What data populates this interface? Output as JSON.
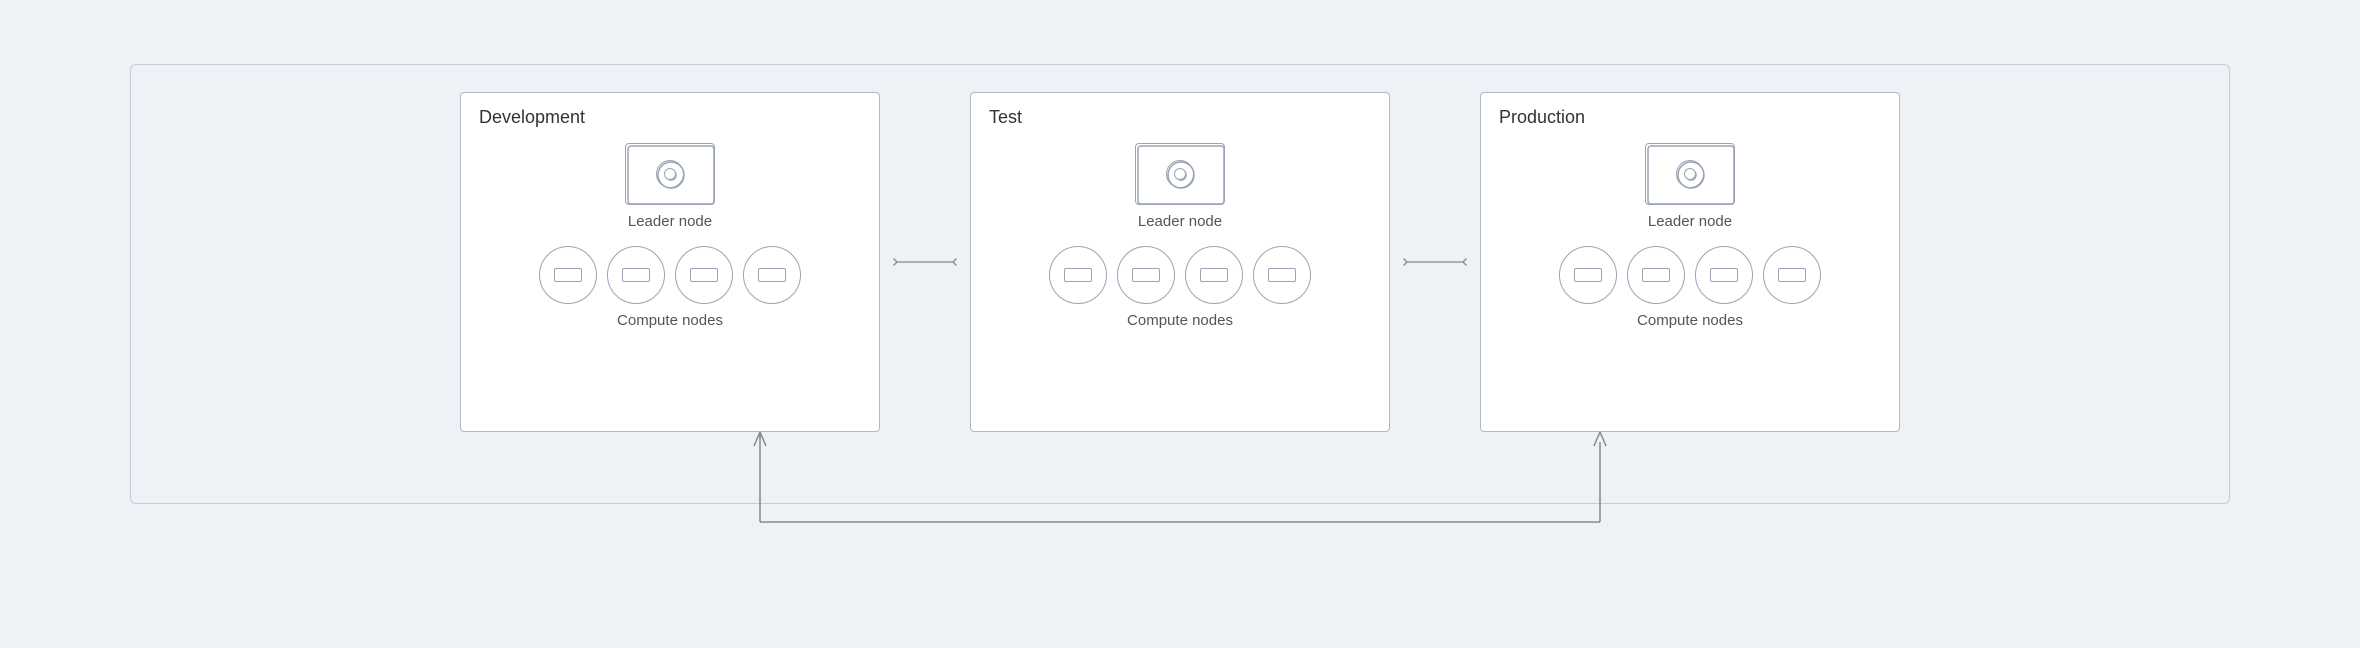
{
  "environments": [
    {
      "id": "development",
      "title": "Development",
      "leader_label": "Leader node",
      "compute_label": "Compute nodes",
      "compute_count": 4
    },
    {
      "id": "test",
      "title": "Test",
      "leader_label": "Leader node",
      "compute_label": "Compute nodes",
      "compute_count": 4
    },
    {
      "id": "production",
      "title": "Production",
      "leader_label": "Leader node",
      "compute_label": "Compute nodes",
      "compute_count": 4
    }
  ],
  "arrows": {
    "horizontal": "↔",
    "up": "↑"
  }
}
